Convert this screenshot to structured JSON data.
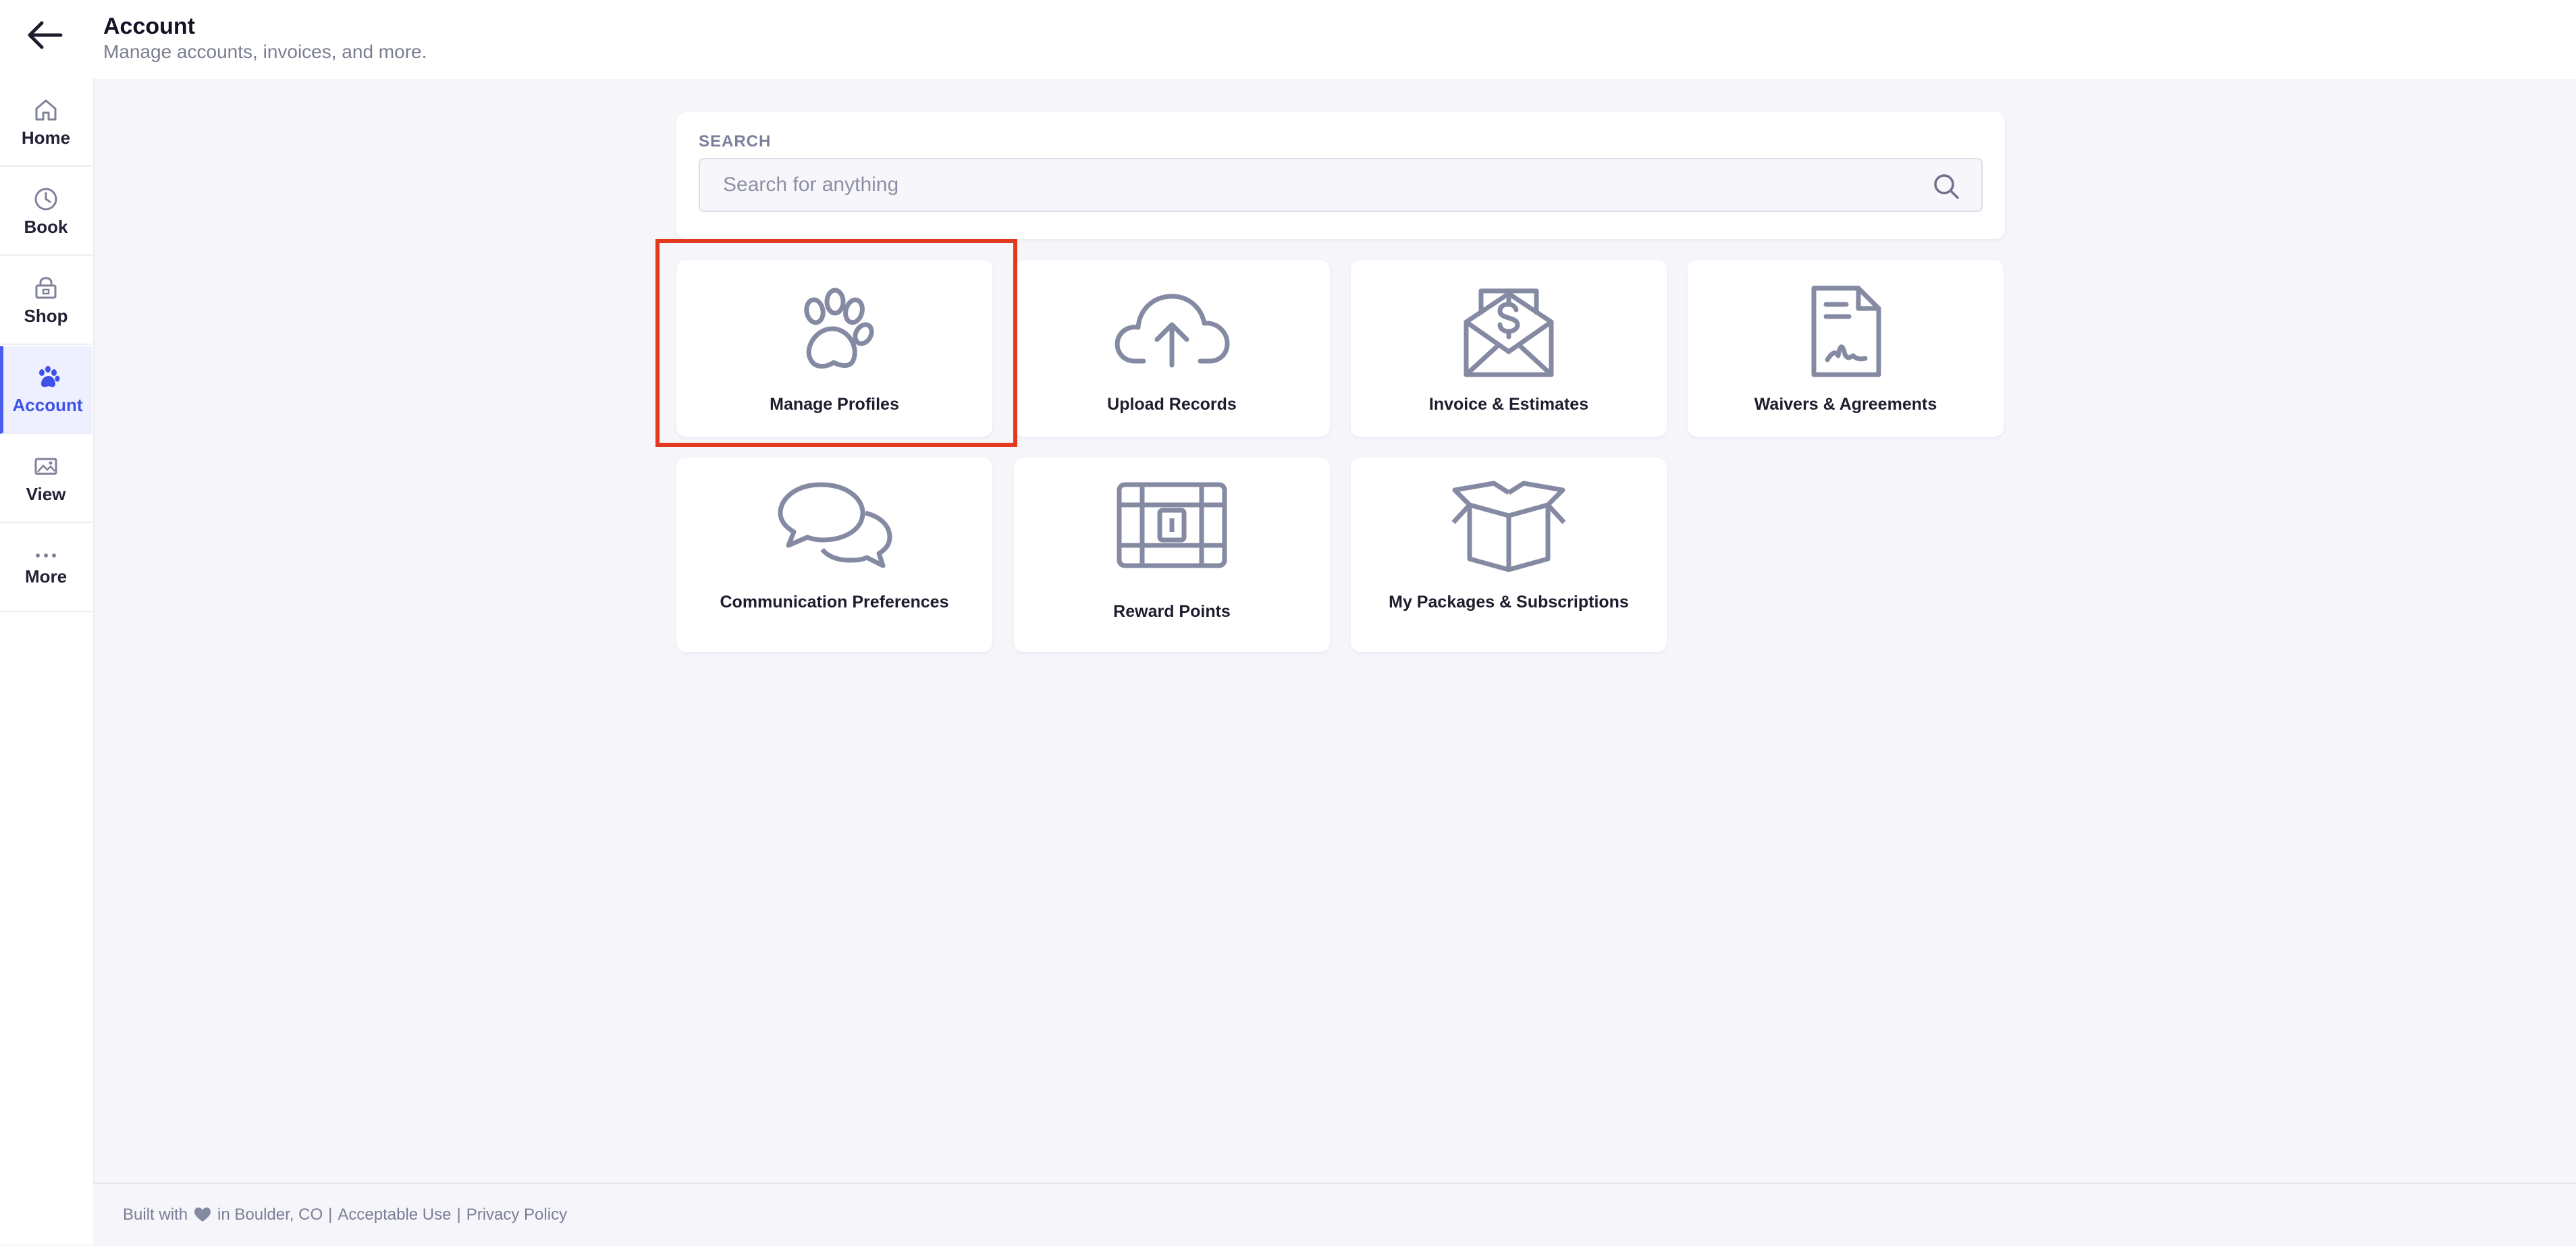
{
  "header": {
    "title": "Account",
    "subtitle": "Manage accounts, invoices, and more."
  },
  "sidebar": {
    "items": [
      {
        "label": "Home",
        "icon": "home-icon"
      },
      {
        "label": "Book",
        "icon": "clock-icon"
      },
      {
        "label": "Shop",
        "icon": "shop-icon"
      },
      {
        "label": "Account",
        "icon": "paw-icon",
        "active": true
      },
      {
        "label": "View",
        "icon": "image-icon"
      },
      {
        "label": "More",
        "icon": "more-dots-icon"
      }
    ]
  },
  "search": {
    "label": "SEARCH",
    "placeholder": "Search for anything",
    "value": ""
  },
  "tiles": [
    {
      "label": "Manage Profiles",
      "icon": "paw-icon",
      "highlighted": true
    },
    {
      "label": "Upload Records",
      "icon": "cloud-upload-icon"
    },
    {
      "label": "Invoice & Estimates",
      "icon": "invoice-envelope-icon"
    },
    {
      "label": "Waivers & Agreements",
      "icon": "signed-document-icon"
    },
    {
      "label": "Communication Preferences",
      "icon": "chat-bubbles-icon"
    },
    {
      "label": "Reward Points",
      "icon": "treasure-chest-icon"
    },
    {
      "label": "My Packages & Subscriptions",
      "icon": "open-box-icon"
    }
  ],
  "footer": {
    "built_with": "Built with",
    "location": "in Boulder, CO",
    "separator": "|",
    "links": [
      "Acceptable Use",
      "Privacy Policy"
    ]
  },
  "colors": {
    "accent": "#4a5cf0",
    "icon_gray": "#858aa3",
    "highlight": "#e23a1e",
    "background": "#f5f5fa"
  }
}
